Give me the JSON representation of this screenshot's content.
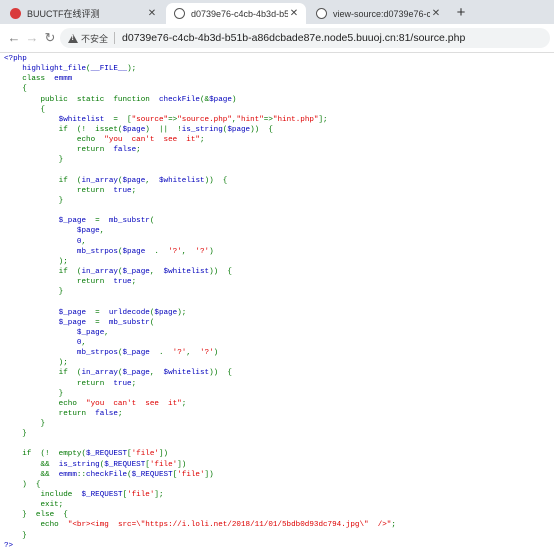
{
  "tabs": [
    {
      "title": "BUUCTF在线评测",
      "favicon": "buuctf-icon",
      "active": false
    },
    {
      "title": "d0739e76-c4cb-4b3d-b51b-",
      "favicon": "globe-icon",
      "active": true
    },
    {
      "title": "view-source:d0739e76-c4cb-",
      "favicon": "globe-icon",
      "active": false
    }
  ],
  "new_tab": "+",
  "address": {
    "security_label": "不安全",
    "url": "d0739e76-c4cb-4b3d-b51b-a86dcbade87e.node5.buuoj.cn:81/source.php"
  },
  "colors": {
    "keyword": "#007700",
    "string": "#dd0000",
    "default": "#0000bb",
    "tabbar": "#dfe3e8"
  },
  "source_lines": [
    [
      [
        "def",
        "<?php"
      ]
    ],
    [
      [
        "def",
        "    highlight_file"
      ],
      [
        "kw",
        "("
      ],
      [
        "def",
        "__FILE__"
      ],
      [
        "kw",
        ");"
      ]
    ],
    [
      [
        "kw",
        "    class  "
      ],
      [
        "def",
        "emmm"
      ]
    ],
    [
      [
        "kw",
        "    {"
      ]
    ],
    [
      [
        "kw",
        "        public  static  function  "
      ],
      [
        "def",
        "checkFile"
      ],
      [
        "kw",
        "(&"
      ],
      [
        "def",
        "$page"
      ],
      [
        "kw",
        ")"
      ]
    ],
    [
      [
        "kw",
        "        {"
      ]
    ],
    [
      [
        "def",
        "            $whitelist  "
      ],
      [
        "kw",
        "=  ["
      ],
      [
        "str",
        "\"source\""
      ],
      [
        "kw",
        "=>"
      ],
      [
        "str",
        "\"source.php\""
      ],
      [
        "kw",
        ","
      ],
      [
        "str",
        "\"hint\""
      ],
      [
        "kw",
        "=>"
      ],
      [
        "str",
        "\"hint.php\""
      ],
      [
        "kw",
        "];"
      ]
    ],
    [
      [
        "kw",
        "            if  (!  isset("
      ],
      [
        "def",
        "$page"
      ],
      [
        "kw",
        ")  ||  !"
      ],
      [
        "def",
        "is_string"
      ],
      [
        "kw",
        "("
      ],
      [
        "def",
        "$page"
      ],
      [
        "kw",
        "))  {"
      ]
    ],
    [
      [
        "kw",
        "                echo  "
      ],
      [
        "str",
        "\"you  can't  see  it\""
      ],
      [
        "kw",
        ";"
      ]
    ],
    [
      [
        "kw",
        "                return  "
      ],
      [
        "def",
        "false"
      ],
      [
        "kw",
        ";"
      ]
    ],
    [
      [
        "kw",
        "            }"
      ]
    ],
    [],
    [
      [
        "kw",
        "            if  ("
      ],
      [
        "def",
        "in_array"
      ],
      [
        "kw",
        "("
      ],
      [
        "def",
        "$page"
      ],
      [
        "kw",
        ",  "
      ],
      [
        "def",
        "$whitelist"
      ],
      [
        "kw",
        "))  {"
      ]
    ],
    [
      [
        "kw",
        "                return  "
      ],
      [
        "def",
        "true"
      ],
      [
        "kw",
        ";"
      ]
    ],
    [
      [
        "kw",
        "            }"
      ]
    ],
    [],
    [
      [
        "def",
        "            $_page  "
      ],
      [
        "kw",
        "=  "
      ],
      [
        "def",
        "mb_substr"
      ],
      [
        "kw",
        "("
      ]
    ],
    [
      [
        "def",
        "                $page"
      ],
      [
        "kw",
        ","
      ]
    ],
    [
      [
        "def",
        "                0"
      ],
      [
        "kw",
        ","
      ]
    ],
    [
      [
        "def",
        "                mb_strpos"
      ],
      [
        "kw",
        "("
      ],
      [
        "def",
        "$page  "
      ],
      [
        "kw",
        ".  "
      ],
      [
        "str",
        "'?'"
      ],
      [
        "kw",
        ",  "
      ],
      [
        "str",
        "'?'"
      ],
      [
        "kw",
        ")"
      ]
    ],
    [
      [
        "kw",
        "            );"
      ]
    ],
    [
      [
        "kw",
        "            if  ("
      ],
      [
        "def",
        "in_array"
      ],
      [
        "kw",
        "("
      ],
      [
        "def",
        "$_page"
      ],
      [
        "kw",
        ",  "
      ],
      [
        "def",
        "$whitelist"
      ],
      [
        "kw",
        "))  {"
      ]
    ],
    [
      [
        "kw",
        "                return  "
      ],
      [
        "def",
        "true"
      ],
      [
        "kw",
        ";"
      ]
    ],
    [
      [
        "kw",
        "            }"
      ]
    ],
    [],
    [
      [
        "def",
        "            $_page  "
      ],
      [
        "kw",
        "=  "
      ],
      [
        "def",
        "urldecode"
      ],
      [
        "kw",
        "("
      ],
      [
        "def",
        "$page"
      ],
      [
        "kw",
        ");"
      ]
    ],
    [
      [
        "def",
        "            $_page  "
      ],
      [
        "kw",
        "=  "
      ],
      [
        "def",
        "mb_substr"
      ],
      [
        "kw",
        "("
      ]
    ],
    [
      [
        "def",
        "                $_page"
      ],
      [
        "kw",
        ","
      ]
    ],
    [
      [
        "def",
        "                0"
      ],
      [
        "kw",
        ","
      ]
    ],
    [
      [
        "def",
        "                mb_strpos"
      ],
      [
        "kw",
        "("
      ],
      [
        "def",
        "$_page  "
      ],
      [
        "kw",
        ".  "
      ],
      [
        "str",
        "'?'"
      ],
      [
        "kw",
        ",  "
      ],
      [
        "str",
        "'?'"
      ],
      [
        "kw",
        ")"
      ]
    ],
    [
      [
        "kw",
        "            );"
      ]
    ],
    [
      [
        "kw",
        "            if  ("
      ],
      [
        "def",
        "in_array"
      ],
      [
        "kw",
        "("
      ],
      [
        "def",
        "$_page"
      ],
      [
        "kw",
        ",  "
      ],
      [
        "def",
        "$whitelist"
      ],
      [
        "kw",
        "))  {"
      ]
    ],
    [
      [
        "kw",
        "                return  "
      ],
      [
        "def",
        "true"
      ],
      [
        "kw",
        ";"
      ]
    ],
    [
      [
        "kw",
        "            }"
      ]
    ],
    [
      [
        "kw",
        "            echo  "
      ],
      [
        "str",
        "\"you  can't  see  it\""
      ],
      [
        "kw",
        ";"
      ]
    ],
    [
      [
        "kw",
        "            return  "
      ],
      [
        "def",
        "false"
      ],
      [
        "kw",
        ";"
      ]
    ],
    [
      [
        "kw",
        "        }"
      ]
    ],
    [
      [
        "kw",
        "    }"
      ]
    ],
    [],
    [
      [
        "kw",
        "    if  (!  empty("
      ],
      [
        "def",
        "$_REQUEST"
      ],
      [
        "kw",
        "["
      ],
      [
        "str",
        "'file'"
      ],
      [
        "kw",
        "])"
      ]
    ],
    [
      [
        "kw",
        "        &&  "
      ],
      [
        "def",
        "is_string"
      ],
      [
        "kw",
        "("
      ],
      [
        "def",
        "$_REQUEST"
      ],
      [
        "kw",
        "["
      ],
      [
        "str",
        "'file'"
      ],
      [
        "kw",
        "])"
      ]
    ],
    [
      [
        "kw",
        "        &&  "
      ],
      [
        "def",
        "emmm"
      ],
      [
        "kw",
        "::"
      ],
      [
        "def",
        "checkFile"
      ],
      [
        "kw",
        "("
      ],
      [
        "def",
        "$_REQUEST"
      ],
      [
        "kw",
        "["
      ],
      [
        "str",
        "'file'"
      ],
      [
        "kw",
        "])"
      ]
    ],
    [
      [
        "kw",
        "    )  {"
      ]
    ],
    [
      [
        "kw",
        "        include  "
      ],
      [
        "def",
        "$_REQUEST"
      ],
      [
        "kw",
        "["
      ],
      [
        "str",
        "'file'"
      ],
      [
        "kw",
        "];"
      ]
    ],
    [
      [
        "kw",
        "        exit;"
      ]
    ],
    [
      [
        "kw",
        "    }  else  {"
      ]
    ],
    [
      [
        "kw",
        "        echo  "
      ],
      [
        "str",
        "\"<br><img  src=\\\"https://i.loli.net/2018/11/01/5bdb0d93dc794.jpg\\\"  />\""
      ],
      [
        "kw",
        ";"
      ]
    ],
    [
      [
        "kw",
        "    }"
      ]
    ],
    [
      [
        "def",
        "?>"
      ]
    ]
  ]
}
